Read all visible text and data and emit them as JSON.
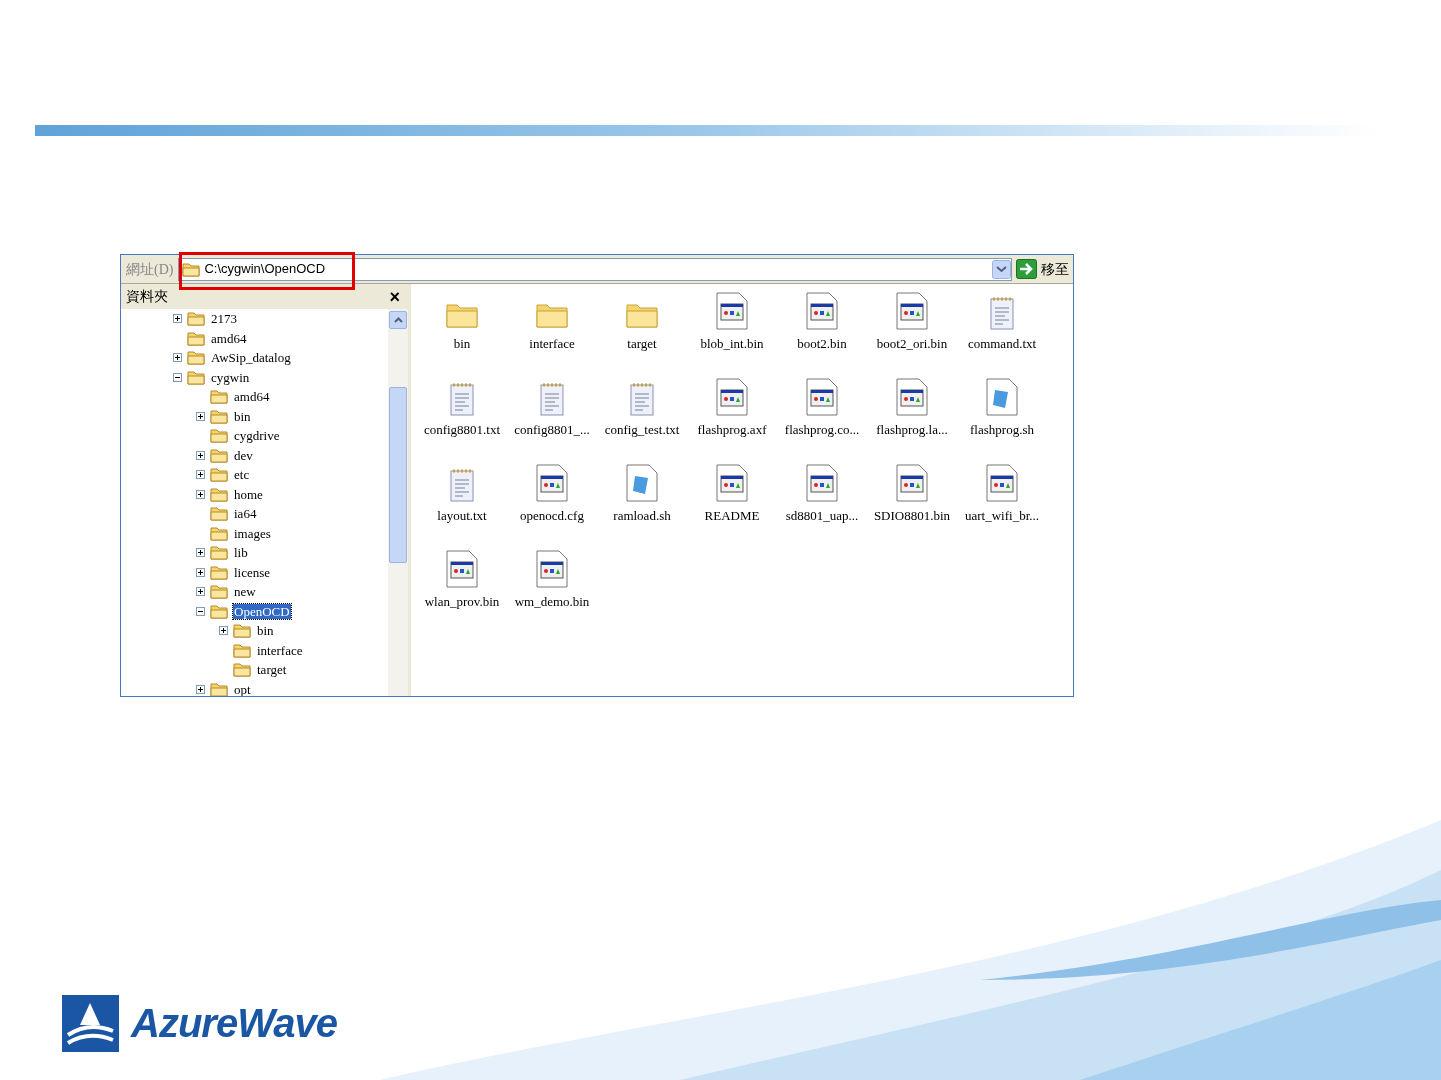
{
  "address_bar": {
    "label": "網址(D)",
    "path": "C:\\cygwin\\OpenOCD",
    "go_button": "移至"
  },
  "folders_pane": {
    "title": "資料夾",
    "close": "×",
    "tree": [
      {
        "label": "2173",
        "kind": "plus",
        "selected": false
      },
      {
        "label": "amd64",
        "kind": "leaf",
        "selected": false
      },
      {
        "label": "AwSip_datalog",
        "kind": "plus",
        "selected": false
      },
      {
        "label": "cygwin",
        "kind": "minus",
        "selected": false,
        "children": [
          {
            "label": "amd64",
            "kind": "leaf",
            "selected": false
          },
          {
            "label": "bin",
            "kind": "plus",
            "selected": false
          },
          {
            "label": "cygdrive",
            "kind": "leaf",
            "selected": false
          },
          {
            "label": "dev",
            "kind": "plus",
            "selected": false
          },
          {
            "label": "etc",
            "kind": "plus",
            "selected": false
          },
          {
            "label": "home",
            "kind": "plus",
            "selected": false
          },
          {
            "label": "ia64",
            "kind": "leaf",
            "selected": false
          },
          {
            "label": "images",
            "kind": "leaf",
            "selected": false
          },
          {
            "label": "lib",
            "kind": "plus",
            "selected": false
          },
          {
            "label": "license",
            "kind": "plus",
            "selected": false
          },
          {
            "label": "new",
            "kind": "plus",
            "selected": false
          },
          {
            "label": "OpenOCD",
            "kind": "minus",
            "selected": true,
            "children": [
              {
                "label": "bin",
                "kind": "plus",
                "selected": false
              },
              {
                "label": "interface",
                "kind": "leaf",
                "selected": false
              },
              {
                "label": "target",
                "kind": "leaf",
                "selected": false
              }
            ]
          },
          {
            "label": "opt",
            "kind": "plus",
            "selected": false
          }
        ]
      }
    ]
  },
  "files": [
    {
      "name": "bin",
      "kind": "folder"
    },
    {
      "name": "interface",
      "kind": "folder"
    },
    {
      "name": "target",
      "kind": "folder"
    },
    {
      "name": "blob_int.bin",
      "kind": "app"
    },
    {
      "name": "boot2.bin",
      "kind": "app"
    },
    {
      "name": "boot2_ori.bin",
      "kind": "app"
    },
    {
      "name": "command.txt",
      "kind": "text"
    },
    {
      "name": "config8801.txt",
      "kind": "text"
    },
    {
      "name": "config8801_...",
      "kind": "text"
    },
    {
      "name": "config_test.txt",
      "kind": "text"
    },
    {
      "name": "flashprog.axf",
      "kind": "app"
    },
    {
      "name": "flashprog.co...",
      "kind": "app"
    },
    {
      "name": "flashprog.la...",
      "kind": "app"
    },
    {
      "name": "flashprog.sh",
      "kind": "script"
    },
    {
      "name": "layout.txt",
      "kind": "text"
    },
    {
      "name": "openocd.cfg",
      "kind": "app"
    },
    {
      "name": "ramload.sh",
      "kind": "script"
    },
    {
      "name": "README",
      "kind": "app"
    },
    {
      "name": "sd8801_uap...",
      "kind": "app"
    },
    {
      "name": "SDIO8801.bin",
      "kind": "app"
    },
    {
      "name": "uart_wifi_br...",
      "kind": "app"
    },
    {
      "name": "wlan_prov.bin",
      "kind": "app"
    },
    {
      "name": "wm_demo.bin",
      "kind": "app"
    }
  ],
  "logo": {
    "text": "AzureWave"
  }
}
